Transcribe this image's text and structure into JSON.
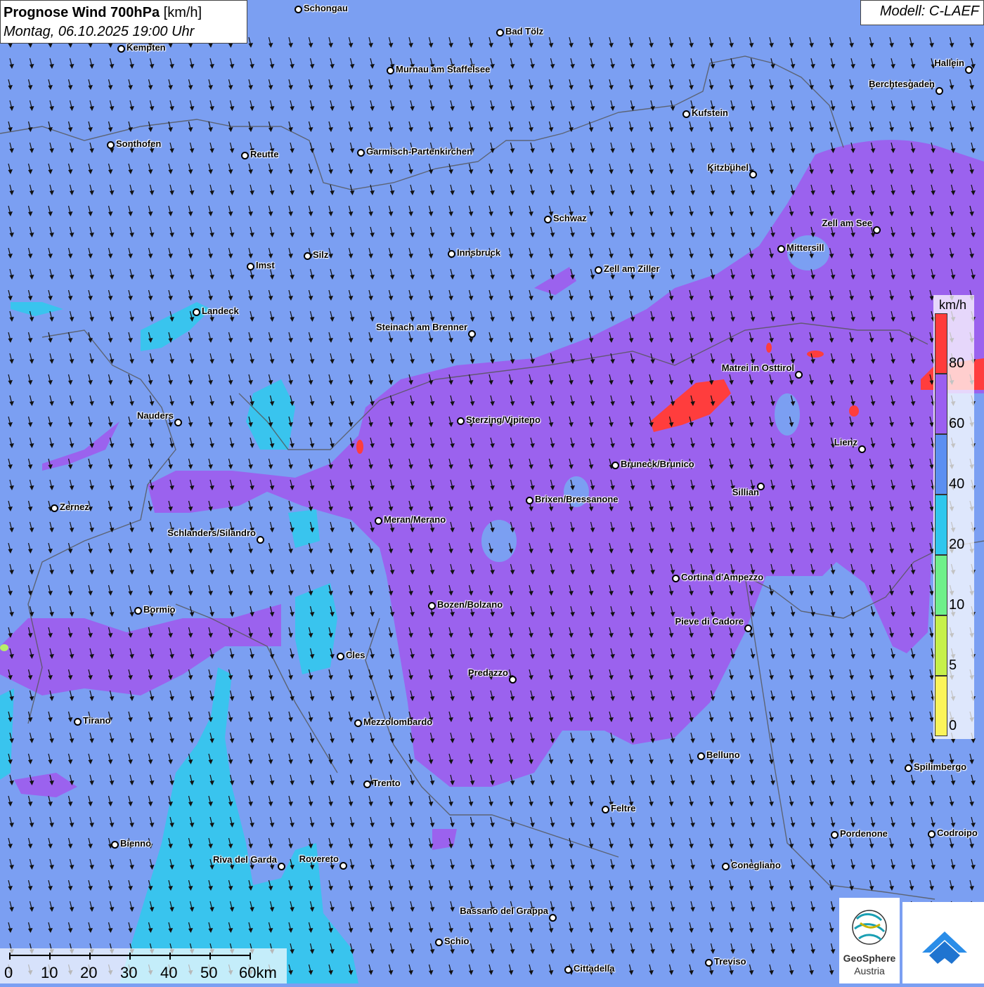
{
  "header": {
    "title_bold": "Prognose Wind 700hPa",
    "title_unit": "[km/h]",
    "datetime": "Montag, 06.10.2025 19:00 Uhr",
    "model": "Modell: C-LAEF"
  },
  "legend": {
    "unit": "km/h",
    "segments": [
      {
        "label": "80",
        "color": "#ff3b3b"
      },
      {
        "label": "60",
        "color": "#9b5ff0"
      },
      {
        "label": "40",
        "color": "#5b8ff2"
      },
      {
        "label": "20",
        "color": "#2fc7ee"
      },
      {
        "label": "10",
        "color": "#6ef08a"
      },
      {
        "label": "5",
        "color": "#c6f04a"
      },
      {
        "label": "0",
        "color": "#fbf45a"
      }
    ]
  },
  "scale_bar": {
    "labels": [
      "0",
      "10",
      "20",
      "30",
      "40",
      "50",
      "60km"
    ]
  },
  "logos": {
    "geosphere_name": "GeoSphere",
    "geosphere_sub": "Austria"
  },
  "cities": [
    {
      "name": "Schongau"
    },
    {
      "name": "Bad Tölz"
    },
    {
      "name": "Kempten"
    },
    {
      "name": "Murnau am Staffelsee"
    },
    {
      "name": "Hallein"
    },
    {
      "name": "Berchtesgaden"
    },
    {
      "name": "Kufstein"
    },
    {
      "name": "Sonthofen"
    },
    {
      "name": "Reutte"
    },
    {
      "name": "Garmisch-Partenkirchen"
    },
    {
      "name": "Kitzbühel"
    },
    {
      "name": "Schwaz"
    },
    {
      "name": "Zell am See"
    },
    {
      "name": "Mittersill"
    },
    {
      "name": "Silz"
    },
    {
      "name": "Innsbruck"
    },
    {
      "name": "Imst"
    },
    {
      "name": "Zell am Ziller"
    },
    {
      "name": "Landeck"
    },
    {
      "name": "Steinach am Brenner"
    },
    {
      "name": "Matrei in Osttirol"
    },
    {
      "name": "Nauders"
    },
    {
      "name": "Sterzing/Vipiteno"
    },
    {
      "name": "Lienz"
    },
    {
      "name": "Bruneck/Brunico"
    },
    {
      "name": "Sillian"
    },
    {
      "name": "Zernez"
    },
    {
      "name": "Brixen/Bressanone"
    },
    {
      "name": "Meran/Merano"
    },
    {
      "name": "Schlanders/Silandro"
    },
    {
      "name": "Cortina d'Ampezzo"
    },
    {
      "name": "Bormio"
    },
    {
      "name": "Bozen/Bolzano"
    },
    {
      "name": "Pieve di Cadore"
    },
    {
      "name": "Cles"
    },
    {
      "name": "Predazzo"
    },
    {
      "name": "Tirano"
    },
    {
      "name": "Mezzolombardo"
    },
    {
      "name": "Belluno"
    },
    {
      "name": "Spilimbergo"
    },
    {
      "name": "Trento"
    },
    {
      "name": "Feltre"
    },
    {
      "name": "Bienno"
    },
    {
      "name": "Pordenone"
    },
    {
      "name": "Codroipo"
    },
    {
      "name": "Riva del Garda"
    },
    {
      "name": "Rovereto"
    },
    {
      "name": "Conegliano"
    },
    {
      "name": "Bassano del Grappa"
    },
    {
      "name": "Schio"
    },
    {
      "name": "Treviso"
    },
    {
      "name": "Cittadella"
    }
  ]
}
